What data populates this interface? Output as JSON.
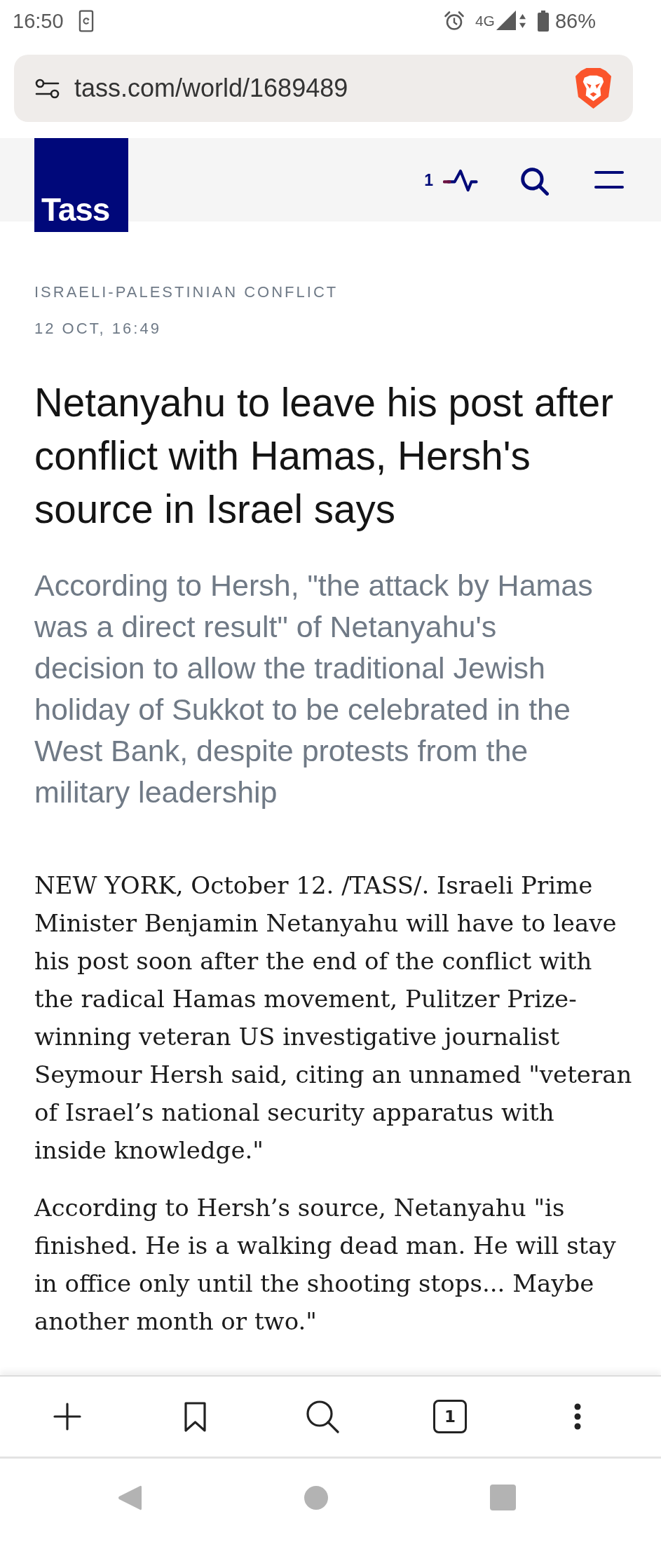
{
  "status_bar": {
    "time": "16:50",
    "network": "4G",
    "battery": "86%"
  },
  "address_bar": {
    "url": "tass.com/world/1689489"
  },
  "site_header": {
    "logo": "Tass",
    "live_count": "1"
  },
  "article": {
    "category": "ISRAELI-PALESTINIAN CONFLICT",
    "date": "12 OCT, 16:49",
    "headline": "Netanyahu to leave his post after conflict with Hamas, Hersh's source in Israel says",
    "lead": "According to Hersh, \"the attack by Hamas was a direct result\" of Netanyahu's decision to allow the traditional Jewish holiday of Sukkot to be celebrated in the West Bank, despite protests from the military leadership",
    "paragraphs": [
      "NEW YORK, October 12. /TASS/. Israeli Prime Minister Benjamin Netanyahu will have to leave his post soon after the end of the conflict with the radical Hamas movement, Pulitzer Prize-winning veteran US investigative journalist Seymour Hersh said, citing an unnamed \"veteran of Israel’s national security apparatus with inside knowledge.\"",
      "According to Hersh’s source, Netanyahu \"is finished. He is a walking dead man. He will stay in office only until the shooting stops... Maybe another month or two.\""
    ]
  },
  "browser_toolbar": {
    "tab_count": "1"
  }
}
